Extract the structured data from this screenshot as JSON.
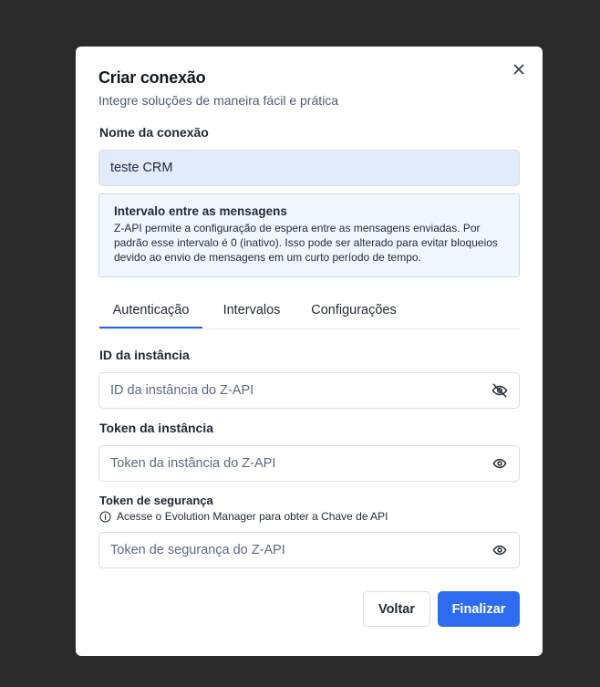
{
  "dialog": {
    "title": "Criar conexão",
    "subtitle": "Integre soluções de maneira fácil e prática",
    "close_icon": "close-icon"
  },
  "connection_name": {
    "label": "Nome da conexão",
    "value": "teste CRM"
  },
  "info_box": {
    "title": "Intervalo entre as mensagens",
    "text": "Z-API permite a configuração de espera entre as mensagens enviadas. Por padrão esse intervalo é 0 (inativo). Isso pode ser alterado para evitar bloqueios devido ao envio de mensagens em um curto período de tempo."
  },
  "tabs": [
    {
      "label": "Autenticação",
      "active": true
    },
    {
      "label": "Intervalos",
      "active": false
    },
    {
      "label": "Configurações",
      "active": false
    }
  ],
  "instance_id": {
    "label": "ID da instância",
    "placeholder": "ID da instância do Z-API",
    "icon": "eye-off-icon"
  },
  "instance_token": {
    "label": "Token da instância",
    "placeholder": "Token da instância do Z-API",
    "icon": "eye-icon"
  },
  "security_token": {
    "label": "Token de segurança",
    "hint": "Acesse o Evolution Manager para obter a Chave de API",
    "placeholder": "Token de segurança do Z-API",
    "icon": "eye-icon"
  },
  "actions": {
    "back_label": "Voltar",
    "finish_label": "Finalizar"
  },
  "colors": {
    "backdrop": "#2a2a2a",
    "primary": "#2d6cf0",
    "filled_input_bg": "#e2ebfb",
    "info_bg": "#f0f7fe",
    "info_border": "#bcdcf3"
  }
}
